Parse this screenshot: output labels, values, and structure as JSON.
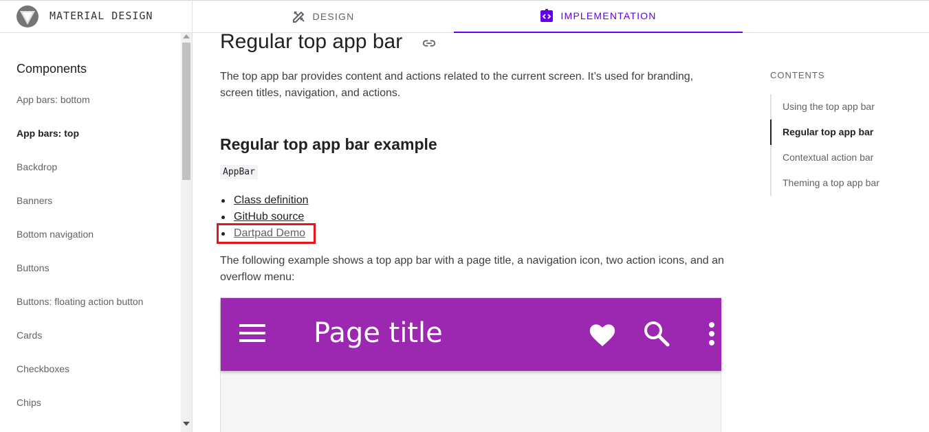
{
  "header": {
    "brand_text": "MATERIAL DESIGN",
    "tabs": [
      {
        "label": "DESIGN",
        "icon": "design-tools-icon",
        "active": false
      },
      {
        "label": "IMPLEMENTATION",
        "icon": "code-icon",
        "active": true
      }
    ],
    "accent_color": "#6200ee"
  },
  "sidebar": {
    "heading": "Components",
    "items": [
      {
        "label": "App bars: bottom",
        "active": false
      },
      {
        "label": "App bars: top",
        "active": true
      },
      {
        "label": "Backdrop",
        "active": false
      },
      {
        "label": "Banners",
        "active": false
      },
      {
        "label": "Bottom navigation",
        "active": false
      },
      {
        "label": "Buttons",
        "active": false
      },
      {
        "label": "Buttons: floating action button",
        "active": false
      },
      {
        "label": "Cards",
        "active": false
      },
      {
        "label": "Checkboxes",
        "active": false
      },
      {
        "label": "Chips",
        "active": false
      }
    ]
  },
  "main": {
    "page_title": "Regular top app bar",
    "intro": "The top app bar provides content and actions related to the current screen. It’s used for branding, screen titles, navigation, and actions.",
    "section_title": "Regular top app bar example",
    "code_chip": "AppBar",
    "links": [
      {
        "label": "Class definition"
      },
      {
        "label": "GitHub source"
      },
      {
        "label": "Dartpad Demo"
      }
    ],
    "description": "The following example shows a top app bar with a page title, a navigation icon, two action icons, and an overflow menu:",
    "demo": {
      "title": "Page title",
      "appbar_color": "#9c27b0",
      "icons": [
        "menu-icon",
        "heart-icon",
        "search-icon",
        "more-vert-icon"
      ]
    }
  },
  "toc": {
    "heading": "CONTENTS",
    "items": [
      {
        "label": "Using the top app bar",
        "active": false
      },
      {
        "label": "Regular top app bar",
        "active": true
      },
      {
        "label": "Contextual action bar",
        "active": false
      },
      {
        "label": "Theming a top app bar",
        "active": false
      }
    ]
  }
}
